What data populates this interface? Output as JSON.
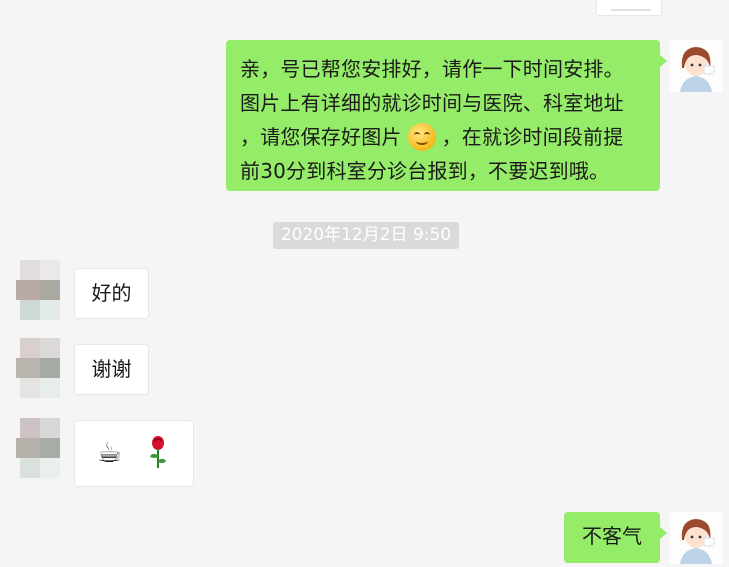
{
  "messages": {
    "instruction": {
      "line1": "亲，号已帮您安排好，请作一下时间安排。",
      "line2": "图片上有详细的就诊时间与医院、科室地址",
      "line3_before": "，请您保存好图片",
      "line3_after": "，在就诊时间段前提",
      "line4": "前30分到科室分诊台报到，不要迟到哦。"
    },
    "timestamp": "2020年12月2日 9:50",
    "reply_ok": "好的",
    "reply_thanks": "谢谢",
    "reply_emoji": [
      "coffee-icon",
      "rose-icon"
    ],
    "reply_welcome": "不客气"
  },
  "colors": {
    "sent_bubble": "#95ec69",
    "received_bubble": "#ffffff",
    "background": "#f5f5f5",
    "timestamp_bg": "#dadada"
  }
}
